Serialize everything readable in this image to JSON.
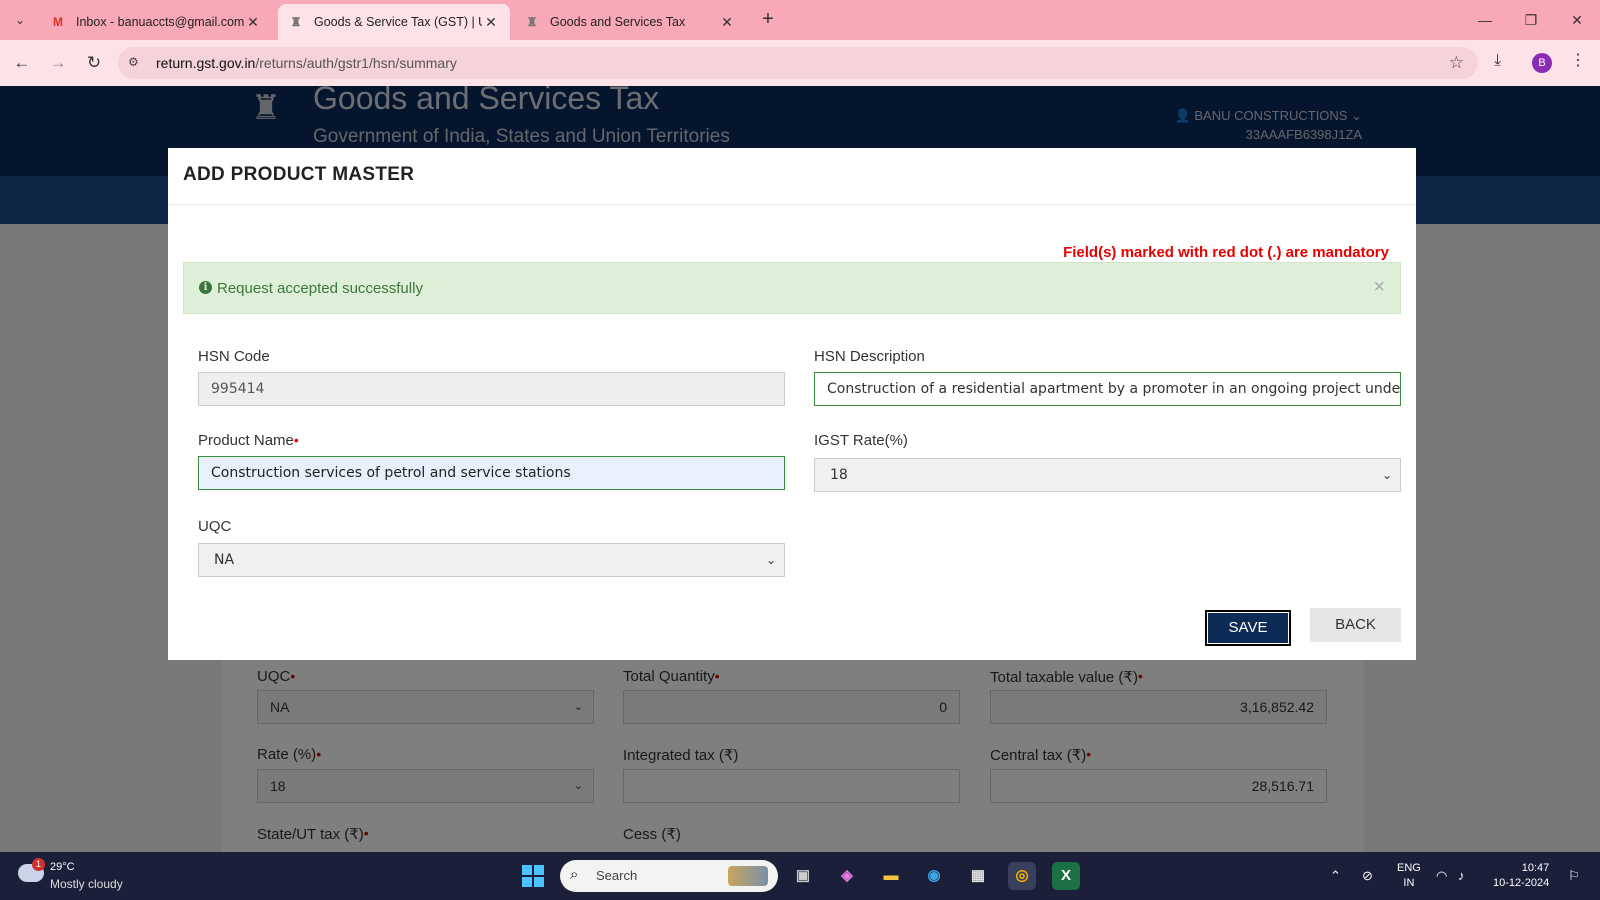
{
  "browser": {
    "tabs": [
      {
        "title": "Inbox - banuaccts@gmail.com -",
        "favicon": "gmail-icon",
        "active": false
      },
      {
        "title": "Goods & Service Tax (GST) | Use",
        "favicon": "gst-emblem-icon",
        "active": true
      },
      {
        "title": "Goods and Services Tax",
        "favicon": "gst-emblem-icon",
        "active": false
      }
    ],
    "url_domain": "return.gst.gov.in",
    "url_path": "/returns/auth/gstr1/hsn/summary",
    "profile_initial": "B",
    "profile_color": "#8a2bb5"
  },
  "site": {
    "title": "Goods and Services Tax",
    "subtitle": "Government of India, States and Union Territories",
    "user_name": "BANU CONSTRUCTIONS",
    "gstin": "33AAAFB6398J1ZA",
    "header_color": "#0a2a5c"
  },
  "background_form": {
    "uqc_label": "UQC",
    "uqc_value": "NA",
    "total_quantity_label": "Total Quantity",
    "total_quantity_value": "0",
    "total_taxable_label": "Total taxable value (₹)",
    "total_taxable_value": "3,16,852.42",
    "rate_label": "Rate (%)",
    "rate_value": "18",
    "integrated_tax_label": "Integrated tax (₹)",
    "integrated_tax_value": "",
    "central_tax_label": "Central tax (₹)",
    "central_tax_value": "28,516.71",
    "state_tax_label": "State/UT tax (₹)",
    "cess_label": "Cess (₹)"
  },
  "modal": {
    "title": "ADD PRODUCT MASTER",
    "mandatory_note": "Field(s) marked with red dot (.) are mandatory",
    "alert_text": "Request accepted successfully",
    "alert_close": "×",
    "hsn_code_label": "HSN Code",
    "hsn_code_value": "995414",
    "hsn_desc_label": "HSN Description",
    "hsn_desc_value": "Construction of a residential apartment by a promoter in an ongoing project under",
    "product_name_label": "Product Name",
    "product_name_value": "Construction services of petrol and service stations",
    "igst_label": "IGST Rate(%)",
    "igst_value": "18",
    "uqc_label": "UQC",
    "uqc_value": "NA",
    "save_label": "SAVE",
    "back_label": "BACK",
    "required_mark": "•"
  },
  "taskbar": {
    "weather_badge": "1",
    "temperature": "29°C",
    "weather": "Mostly cloudy",
    "search_placeholder": "Search",
    "lang_1": "ENG",
    "lang_2": "IN",
    "time": "10:47",
    "date": "10-12-2024"
  }
}
